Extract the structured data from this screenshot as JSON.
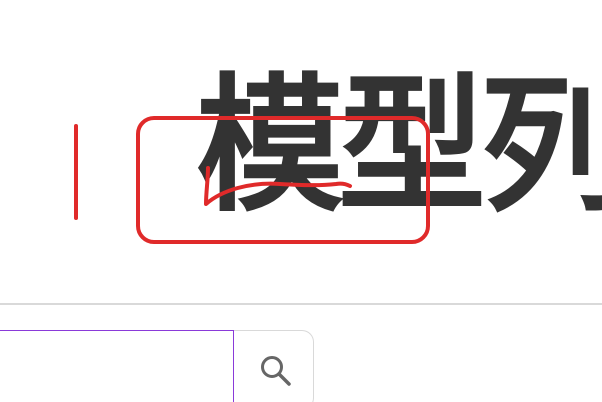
{
  "page": {
    "title": "模型列"
  },
  "search": {
    "input_value": "",
    "placeholder": "",
    "button_icon": "search-icon"
  },
  "colors": {
    "heading": "#333333",
    "annotation": "#e02a2a",
    "input_border_focus": "#8a3ad9",
    "divider": "#d9d9d9",
    "icon": "#666666"
  }
}
